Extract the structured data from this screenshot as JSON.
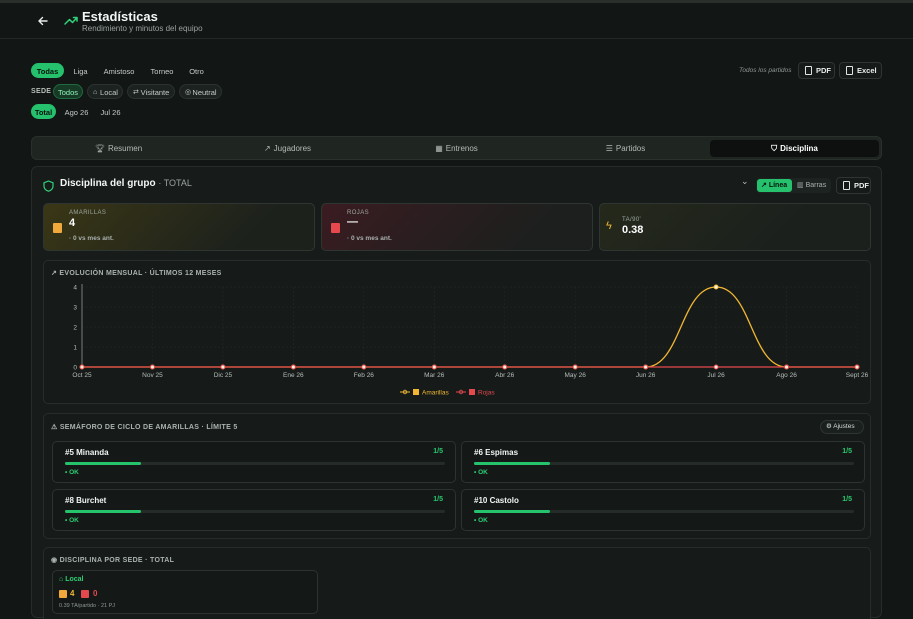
{
  "header": {
    "title": "Estadísticas",
    "subtitle": "Rendimiento y minutos del equipo"
  },
  "filters": {
    "types": [
      "Todas",
      "Liga",
      "Amistoso",
      "Torneo",
      "Otro"
    ],
    "sede_label": "SEDE",
    "sedes": [
      "Todos",
      "Local",
      "Visitante",
      "Neutral"
    ],
    "periods": [
      "Total",
      "Ago 26",
      "Jul 26"
    ],
    "export_note": "Todos los partidos",
    "pdf_label": "PDF",
    "excel_label": "Excel"
  },
  "tabs": [
    "Resumen",
    "Jugadores",
    "Entrenos",
    "Partidos",
    "Disciplina"
  ],
  "discipline": {
    "title": "Disciplina del grupo",
    "scope": "· TOTAL",
    "chart_modes": [
      "Línea",
      "Barras"
    ],
    "pdf_label": "PDF",
    "cards": [
      {
        "key": "AMARILLAS",
        "value": "4",
        "sub": "· 0 vs mes ant."
      },
      {
        "key": "ROJAS",
        "value": "—",
        "sub": "· 0 vs mes ant."
      },
      {
        "key": "TA/90'",
        "value": "0.38",
        "sub": ""
      }
    ]
  },
  "chart_section": {
    "title": "EVOLUCIÓN MENSUAL · ÚLTIMOS 12 MESES"
  },
  "chart_data": {
    "type": "line",
    "categories": [
      "Oct 25",
      "Nov 25",
      "Dic 25",
      "Ene 26",
      "Feb 26",
      "Mar 26",
      "Abr 26",
      "May 26",
      "Jun 26",
      "Jul 26",
      "Ago 26",
      "Sept 26"
    ],
    "series": [
      {
        "name": "Amarillas",
        "values": [
          0,
          0,
          0,
          0,
          0,
          0,
          0,
          0,
          0,
          4,
          0,
          0
        ],
        "color": "#f2b632"
      },
      {
        "name": "Rojas",
        "values": [
          0,
          0,
          0,
          0,
          0,
          0,
          0,
          0,
          0,
          0,
          0,
          0
        ],
        "color": "#e5484d"
      }
    ],
    "ylim": [
      0,
      4
    ],
    "yticks": [
      "0",
      "1",
      "2",
      "3",
      "4"
    ],
    "legend": "bottom",
    "grid": true
  },
  "semaforo": {
    "title": "SEMÁFORO DE CICLO DE AMARILLAS · LÍMITE 5",
    "settings_label": "Ajustes",
    "players": [
      {
        "name": "#5 Minanda",
        "count": "1/5",
        "status": "• OK",
        "fraction": 0.2
      },
      {
        "name": "#6 Espimas",
        "count": "1/5",
        "status": "• OK",
        "fraction": 0.2
      },
      {
        "name": "#8 Burchet",
        "count": "1/5",
        "status": "• OK",
        "fraction": 0.2
      },
      {
        "name": "#10 Castolo",
        "count": "1/5",
        "status": "• OK",
        "fraction": 0.2
      }
    ]
  },
  "por_sede": {
    "title": "DISCIPLINA POR SEDE · TOTAL",
    "label": "Local",
    "yellow": "4",
    "red": "0",
    "detail": "0.39 TA/partido · 21 PJ"
  }
}
